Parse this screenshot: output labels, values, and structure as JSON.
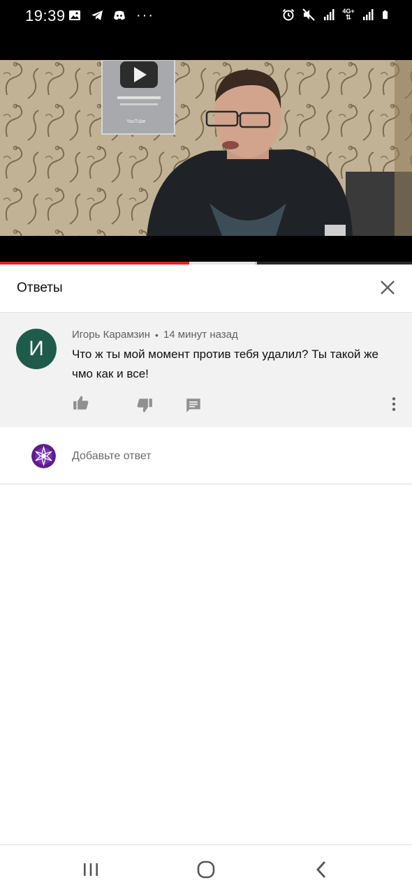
{
  "status_bar": {
    "time": "19:39",
    "left_icons": [
      "image-icon",
      "telegram-icon",
      "discord-icon",
      "more-dots-icon"
    ],
    "more": "···",
    "network": "4G+",
    "right_icons": [
      "alarm-icon",
      "mute-icon",
      "signal-icon",
      "data-4g-icon",
      "signal-icon",
      "battery-icon"
    ]
  },
  "video": {
    "play_button_badge": "YouTube",
    "progress_played_fraction": 0.46,
    "progress_buffered_fraction": 0.62
  },
  "panel": {
    "title": "Ответы",
    "close_icon": "close-icon"
  },
  "comment": {
    "avatar_letter": "И",
    "author": "Игорь Карамзин",
    "separator": "•",
    "time": "14 минут назад",
    "text": "Что ж ты мой момент против тебя удалил? Ты такой же чмо как и все!",
    "actions": [
      "like-icon",
      "dislike-icon",
      "reply-icon",
      "more-vert-icon"
    ],
    "avatar_color": "#1e5b4a"
  },
  "reply": {
    "placeholder": "Добавьте ответ",
    "avatar_color": "#5b1f8a"
  },
  "nav": {
    "buttons": [
      "recent-apps-icon",
      "home-icon",
      "back-icon"
    ]
  },
  "colors": {
    "progress_red": "#e52212",
    "comment_bg": "#f2f2f2"
  }
}
